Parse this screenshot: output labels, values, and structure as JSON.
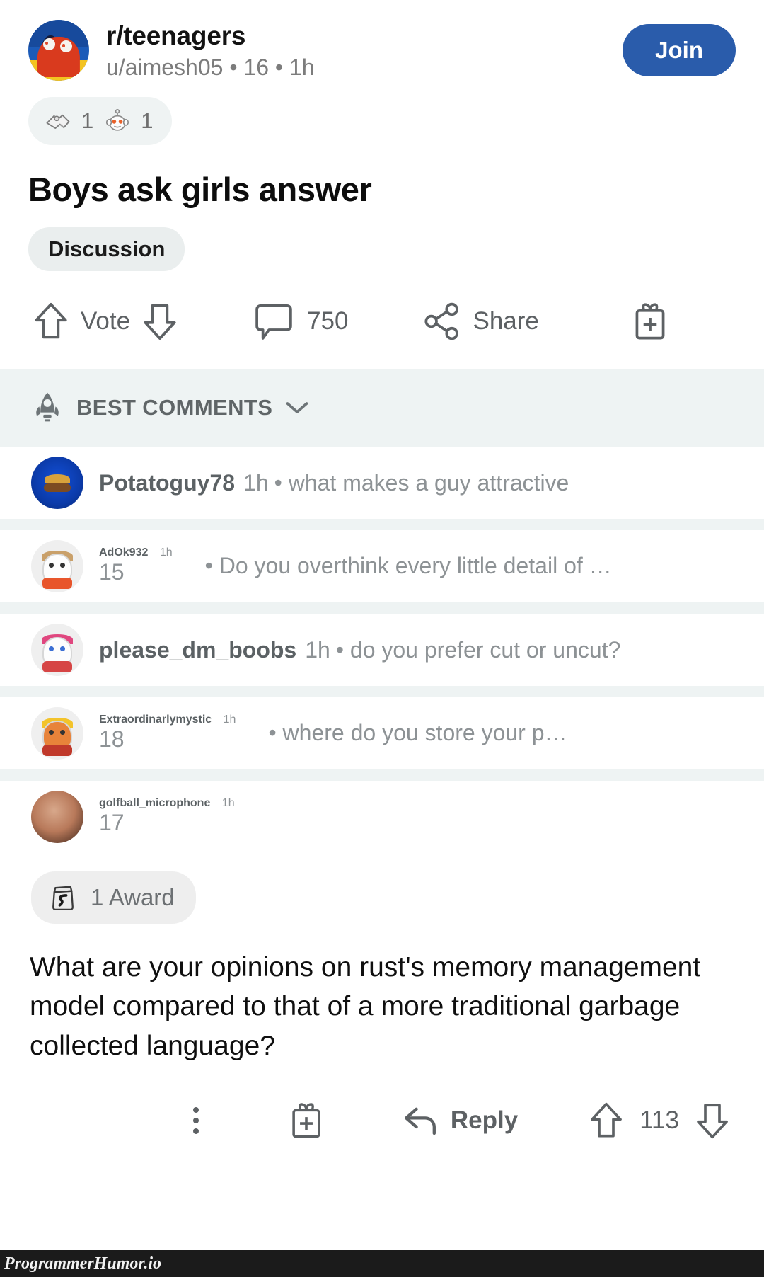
{
  "post": {
    "subreddit": "r/teenagers",
    "meta": "u/aimesh05 • 16 • 1h",
    "join_label": "Join",
    "title": "Boys ask girls answer",
    "flair": "Discussion",
    "awards": [
      {
        "icon": "handshake-award-icon",
        "count": "1"
      },
      {
        "icon": "snoo-award-icon",
        "count": "1"
      }
    ],
    "actions": {
      "vote_label": "Vote",
      "comment_count": "750",
      "share_label": "Share",
      "award_icon": "gift-award-icon",
      "upvote_icon": "upvote-arrow-icon",
      "downvote_icon": "downvote-arrow-icon",
      "comment_icon": "comment-bubble-icon",
      "share_icon": "share-node-icon"
    }
  },
  "comments_section": {
    "sort_label": "BEST COMMENTS",
    "sort_icon": "rocket-icon",
    "chevron_icon": "chevron-down-icon"
  },
  "comment_previews": [
    {
      "user": "Potatoguy78",
      "time": "1h",
      "score": "",
      "text": "• what makes a guy attractive",
      "avatar": "burger-avatar",
      "two_line": false
    },
    {
      "user": "AdOk932",
      "time": "1h",
      "score": "15",
      "text": "• Do you overthink every little detail of …",
      "avatar": "snoo-avatar-orange",
      "two_line": true
    },
    {
      "user": "please_dm_boobs",
      "time": "1h",
      "score": "",
      "text": "• do you prefer cut or uncut?",
      "avatar": "snoo-avatar-pink",
      "two_line": false
    },
    {
      "user": "Extraordinarlymystic",
      "time": "1h",
      "score": "18",
      "text": "• where do you store your p…",
      "avatar": "snoo-avatar-yellow",
      "two_line": true
    },
    {
      "user": "golfball_microphone",
      "time": "1h",
      "score": "17",
      "text": "",
      "avatar": "photo-avatar",
      "two_line": true
    }
  ],
  "main_comment": {
    "award_badge_label": "1 Award",
    "award_badge_icon": "silver-award-icon",
    "body": "What are your opinions on rust's memory management model compared to that of a more traditional garbage collected language?",
    "actions": {
      "more_icon": "kebab-menu-icon",
      "gift_icon": "gift-award-icon",
      "reply_icon": "reply-arrow-icon",
      "reply_label": "Reply",
      "upvote_icon": "upvote-arrow-icon",
      "score": "113",
      "downvote_icon": "downvote-arrow-icon"
    }
  },
  "watermark": {
    "text": "ProgrammerHumor.io"
  },
  "colors": {
    "join_blue": "#2a5cab",
    "section_bg": "#eef3f3",
    "muted_text": "#8d9295",
    "icon_grey": "#5d6164"
  }
}
